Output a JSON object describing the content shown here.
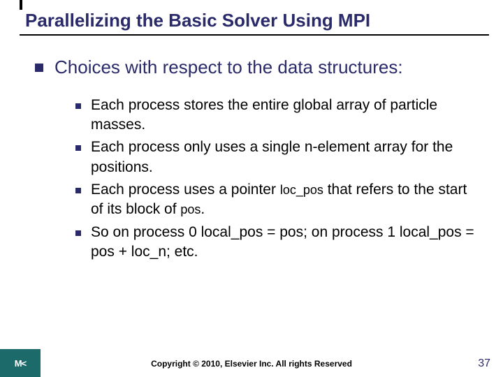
{
  "title": "Parallelizing the Basic Solver Using MPI",
  "lead": "Choices with respect to the data structures:",
  "items": [
    "Each process stores the entire global array of particle masses.",
    "Each process only uses a single n-element array for the positions.",
    "Each process uses a pointer <span class=\"code\">loc_pos</span> that refers to the start of its block of <span class=\"code\">pos</span>.",
    "So on process 0 local_pos = pos; on process 1 local_pos = pos + loc_n; etc."
  ],
  "footer": "Copyright © 2010, Elsevier Inc. All rights Reserved",
  "page": "37",
  "logo": "M<"
}
